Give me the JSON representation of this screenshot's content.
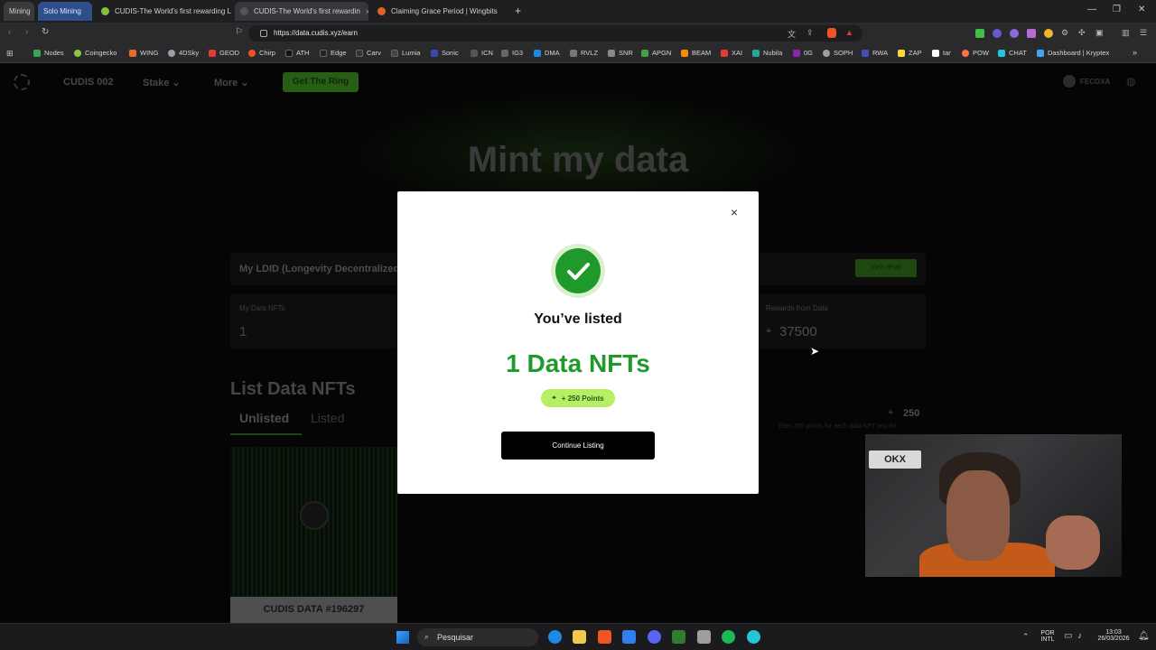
{
  "tabs": [
    {
      "label": "Mining",
      "kind": "group"
    },
    {
      "label": "Solo Mining",
      "kind": "group"
    },
    {
      "label": "CUDIS-The World's first rewarding Lo",
      "color": "#7ec33a"
    },
    {
      "label": "CUDIS-The World's first rewardin",
      "color": "#3a3a3a",
      "active": true,
      "close": "×"
    },
    {
      "label": "Claiming Grace Period | Wingbits",
      "color": "#e0622a"
    }
  ],
  "new_tab": "+",
  "window_buttons": [
    "—",
    "❐",
    "✕"
  ],
  "address": {
    "url": "https://data.cudis.xyz/earn"
  },
  "bookmarks": [
    {
      "label": "Nodes",
      "color": "#34a853"
    },
    {
      "label": "Coingecko",
      "color": "#8dc63f"
    },
    {
      "label": "WING",
      "color": "#e86a2a"
    },
    {
      "label": "4DSky",
      "color": "#9aa0a6"
    },
    {
      "label": "GEOD",
      "color": "#e53935"
    },
    {
      "label": "Chirp",
      "color": "#f4511e"
    },
    {
      "label": "ATH",
      "color": "#111111"
    },
    {
      "label": "Edge",
      "color": "#222222"
    },
    {
      "label": "Carv",
      "color": "#333333"
    },
    {
      "label": "Lumia",
      "color": "#444444"
    },
    {
      "label": "Sonic",
      "color": "#3949ab"
    },
    {
      "label": "ICN",
      "color": "#555555"
    },
    {
      "label": "IG3",
      "color": "#666666"
    },
    {
      "label": "DMA",
      "color": "#1e88e5"
    },
    {
      "label": "RVLZ",
      "color": "#777777"
    },
    {
      "label": "SNR",
      "color": "#888888"
    },
    {
      "label": "APGN",
      "color": "#43a047"
    },
    {
      "label": "BEAM",
      "color": "#fb8c00"
    },
    {
      "label": "XAI",
      "color": "#e53935"
    },
    {
      "label": "Nubila",
      "color": "#26a69a"
    },
    {
      "label": "0G",
      "color": "#8e24aa"
    },
    {
      "label": "SOPH",
      "color": "#9e9e9e"
    },
    {
      "label": "RWA",
      "color": "#3f51b5"
    },
    {
      "label": "ZAP",
      "color": "#fdd835"
    },
    {
      "label": "tar",
      "color": "#ffffff"
    },
    {
      "label": "POW",
      "color": "#ff7043"
    },
    {
      "label": "CHAT",
      "color": "#26c6da"
    },
    {
      "label": "Dashboard | Kryptex",
      "color": "#42a5f5"
    }
  ],
  "nav": {
    "brand": "CUDIS 002",
    "stake": "Stake",
    "more": "More",
    "ring_button": "Get The Ring",
    "user": "FECOXA"
  },
  "hero": "Mint my data",
  "ldid": {
    "label": "My LDID (Longevity Decentralized",
    "view": "View detail"
  },
  "stats": {
    "nfts_label": "My Data NFTs",
    "nfts_value": "1",
    "rewards_label": "Rewards from Data",
    "rewards_value": "37500"
  },
  "list": {
    "title": "List Data NFTs",
    "tab_unlisted": "Unlisted",
    "tab_listed": "Listed",
    "points_value": "250",
    "points_note": "Earn 250 points for each data NFT you list",
    "nft_name": "CUDIS DATA #196297"
  },
  "modal": {
    "close": "×",
    "title": "You’ve listed",
    "count": "1 Data NFTs",
    "points": "+ 250 Points",
    "continue": "Continue Listing"
  },
  "cam": {
    "logo": "OKX"
  },
  "taskbar": {
    "search": "Pesquisar",
    "lang_top": "POR",
    "lang_bottom": "INTL",
    "time": "13:03",
    "date": "26/03/2026"
  }
}
